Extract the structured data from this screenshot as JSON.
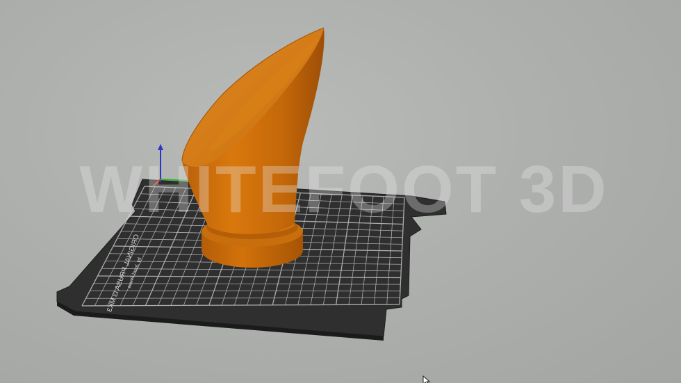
{
  "app": {
    "name": "3D slicer viewport"
  },
  "watermark": {
    "text": "WHITEFOOT 3D"
  },
  "print_bed": {
    "label_line1": "ORIGINAL PRUSA i3 MK3",
    "label_line2": "by Josef Prusa"
  },
  "model": {
    "color": "#d2720a"
  },
  "axes": {
    "x_color": "#d23a2a",
    "y_color": "#36b436",
    "z_color": "#2a36c8"
  },
  "colors": {
    "background": "#aeb0ae",
    "bed": "#2e2f2e",
    "grid": "#d8d8d8"
  }
}
